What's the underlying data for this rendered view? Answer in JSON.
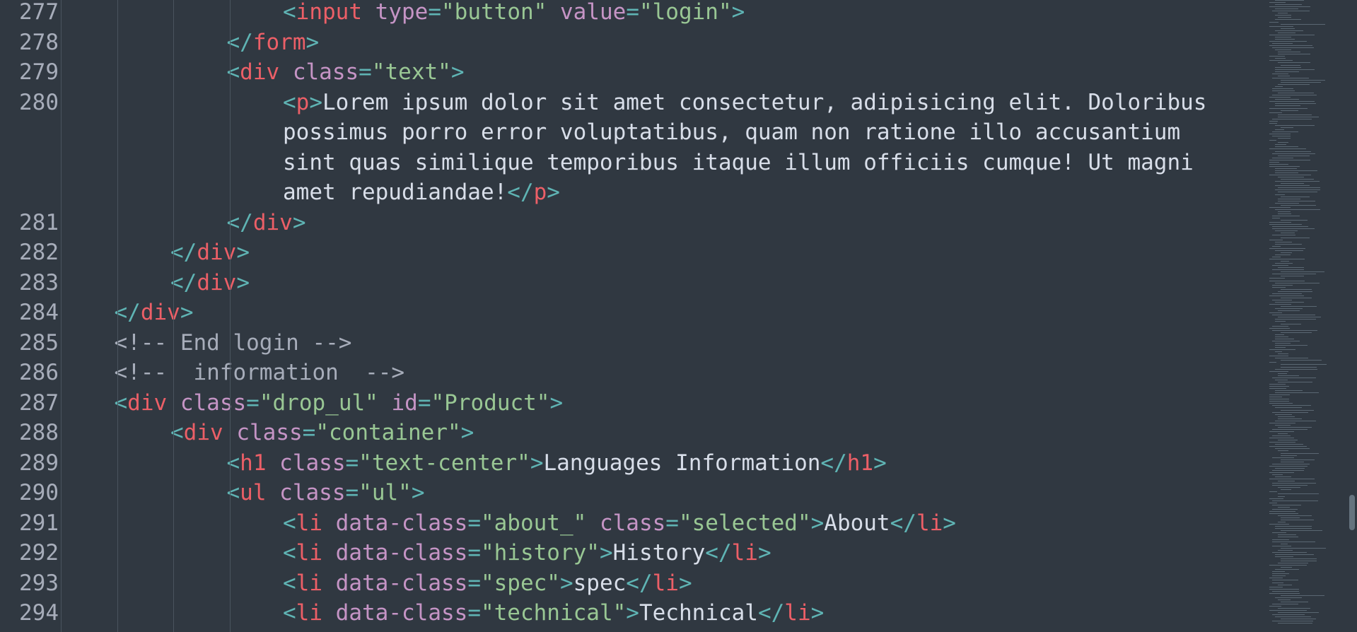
{
  "editor": {
    "lines": [
      {
        "number": "277",
        "indent": 4,
        "tokens": [
          {
            "t": "punct",
            "v": "<"
          },
          {
            "t": "tag",
            "v": "input"
          },
          {
            "t": "txt",
            "v": " "
          },
          {
            "t": "attr",
            "v": "type"
          },
          {
            "t": "punct",
            "v": "="
          },
          {
            "t": "str",
            "v": "\"button\""
          },
          {
            "t": "txt",
            "v": " "
          },
          {
            "t": "attr",
            "v": "value"
          },
          {
            "t": "punct",
            "v": "="
          },
          {
            "t": "str",
            "v": "\"login\""
          },
          {
            "t": "punct",
            "v": ">"
          }
        ]
      },
      {
        "number": "278",
        "indent": 3,
        "tokens": [
          {
            "t": "punct",
            "v": "</"
          },
          {
            "t": "tag",
            "v": "form"
          },
          {
            "t": "punct",
            "v": ">"
          }
        ]
      },
      {
        "number": "279",
        "indent": 3,
        "tokens": [
          {
            "t": "punct",
            "v": "<"
          },
          {
            "t": "tag",
            "v": "div"
          },
          {
            "t": "txt",
            "v": " "
          },
          {
            "t": "attr",
            "v": "class"
          },
          {
            "t": "punct",
            "v": "="
          },
          {
            "t": "str",
            "v": "\"text\""
          },
          {
            "t": "punct",
            "v": ">"
          }
        ]
      },
      {
        "number": "280",
        "indent": 4,
        "wrapped": true,
        "tokens": [
          {
            "t": "punct",
            "v": "<"
          },
          {
            "t": "tag",
            "v": "p"
          },
          {
            "t": "punct",
            "v": ">"
          },
          {
            "t": "txt",
            "v": "Lorem ipsum dolor sit amet consectetur, adipisicing elit. Doloribus possimus porro error voluptatibus, quam non ratione illo accusantium sint quas similique temporibus itaque illum officiis cumque! Ut magni amet repudiandae!"
          },
          {
            "t": "punct",
            "v": "</"
          },
          {
            "t": "tag",
            "v": "p"
          },
          {
            "t": "punct",
            "v": ">"
          }
        ]
      },
      {
        "number": "281",
        "indent": 3,
        "tokens": [
          {
            "t": "punct",
            "v": "</"
          },
          {
            "t": "tag",
            "v": "div"
          },
          {
            "t": "punct",
            "v": ">"
          }
        ]
      },
      {
        "number": "282",
        "indent": 2,
        "tokens": [
          {
            "t": "punct",
            "v": "</"
          },
          {
            "t": "tag",
            "v": "div"
          },
          {
            "t": "punct",
            "v": ">"
          }
        ]
      },
      {
        "number": "283",
        "indent": 2,
        "tokens": [
          {
            "t": "punct",
            "v": "</"
          },
          {
            "t": "tag",
            "v": "div"
          },
          {
            "t": "punct",
            "v": ">"
          }
        ]
      },
      {
        "number": "284",
        "indent": 1,
        "tokens": [
          {
            "t": "punct",
            "v": "</"
          },
          {
            "t": "tag",
            "v": "div"
          },
          {
            "t": "punct",
            "v": ">"
          }
        ]
      },
      {
        "number": "285",
        "indent": 1,
        "tokens": [
          {
            "t": "cmt",
            "v": "<!-- End login -->"
          }
        ]
      },
      {
        "number": "286",
        "indent": 1,
        "tokens": [
          {
            "t": "cmt",
            "v": "<!--  information  -->"
          }
        ]
      },
      {
        "number": "287",
        "indent": 1,
        "tokens": [
          {
            "t": "punct",
            "v": "<"
          },
          {
            "t": "tag",
            "v": "div"
          },
          {
            "t": "txt",
            "v": " "
          },
          {
            "t": "attr",
            "v": "class"
          },
          {
            "t": "punct",
            "v": "="
          },
          {
            "t": "str",
            "v": "\"drop_ul\""
          },
          {
            "t": "txt",
            "v": " "
          },
          {
            "t": "attr",
            "v": "id"
          },
          {
            "t": "punct",
            "v": "="
          },
          {
            "t": "str",
            "v": "\"Product\""
          },
          {
            "t": "punct",
            "v": ">"
          }
        ]
      },
      {
        "number": "288",
        "indent": 2,
        "tokens": [
          {
            "t": "punct",
            "v": "<"
          },
          {
            "t": "tag",
            "v": "div"
          },
          {
            "t": "txt",
            "v": " "
          },
          {
            "t": "attr",
            "v": "class"
          },
          {
            "t": "punct",
            "v": "="
          },
          {
            "t": "str",
            "v": "\"container\""
          },
          {
            "t": "punct",
            "v": ">"
          }
        ]
      },
      {
        "number": "289",
        "indent": 3,
        "tokens": [
          {
            "t": "punct",
            "v": "<"
          },
          {
            "t": "tag",
            "v": "h1"
          },
          {
            "t": "txt",
            "v": " "
          },
          {
            "t": "attr",
            "v": "class"
          },
          {
            "t": "punct",
            "v": "="
          },
          {
            "t": "str",
            "v": "\"text-center\""
          },
          {
            "t": "punct",
            "v": ">"
          },
          {
            "t": "txt",
            "v": "Languages Information"
          },
          {
            "t": "punct",
            "v": "</"
          },
          {
            "t": "tag",
            "v": "h1"
          },
          {
            "t": "punct",
            "v": ">"
          }
        ]
      },
      {
        "number": "290",
        "indent": 3,
        "tokens": [
          {
            "t": "punct",
            "v": "<"
          },
          {
            "t": "tag",
            "v": "ul"
          },
          {
            "t": "txt",
            "v": " "
          },
          {
            "t": "attr",
            "v": "class"
          },
          {
            "t": "punct",
            "v": "="
          },
          {
            "t": "str",
            "v": "\"ul\""
          },
          {
            "t": "punct",
            "v": ">"
          }
        ]
      },
      {
        "number": "291",
        "indent": 4,
        "tokens": [
          {
            "t": "punct",
            "v": "<"
          },
          {
            "t": "tag",
            "v": "li"
          },
          {
            "t": "txt",
            "v": " "
          },
          {
            "t": "attr",
            "v": "data-class"
          },
          {
            "t": "punct",
            "v": "="
          },
          {
            "t": "str",
            "v": "\"about_\""
          },
          {
            "t": "txt",
            "v": " "
          },
          {
            "t": "attr",
            "v": "class"
          },
          {
            "t": "punct",
            "v": "="
          },
          {
            "t": "str",
            "v": "\"selected\""
          },
          {
            "t": "punct",
            "v": ">"
          },
          {
            "t": "txt",
            "v": "About"
          },
          {
            "t": "punct",
            "v": "</"
          },
          {
            "t": "tag",
            "v": "li"
          },
          {
            "t": "punct",
            "v": ">"
          }
        ]
      },
      {
        "number": "292",
        "indent": 4,
        "tokens": [
          {
            "t": "punct",
            "v": "<"
          },
          {
            "t": "tag",
            "v": "li"
          },
          {
            "t": "txt",
            "v": " "
          },
          {
            "t": "attr",
            "v": "data-class"
          },
          {
            "t": "punct",
            "v": "="
          },
          {
            "t": "str",
            "v": "\"history\""
          },
          {
            "t": "punct",
            "v": ">"
          },
          {
            "t": "txt",
            "v": "History"
          },
          {
            "t": "punct",
            "v": "</"
          },
          {
            "t": "tag",
            "v": "li"
          },
          {
            "t": "punct",
            "v": ">"
          }
        ]
      },
      {
        "number": "293",
        "indent": 4,
        "tokens": [
          {
            "t": "punct",
            "v": "<"
          },
          {
            "t": "tag",
            "v": "li"
          },
          {
            "t": "txt",
            "v": " "
          },
          {
            "t": "attr",
            "v": "data-class"
          },
          {
            "t": "punct",
            "v": "="
          },
          {
            "t": "str",
            "v": "\"spec\""
          },
          {
            "t": "punct",
            "v": ">"
          },
          {
            "t": "txt",
            "v": "spec"
          },
          {
            "t": "punct",
            "v": "</"
          },
          {
            "t": "tag",
            "v": "li"
          },
          {
            "t": "punct",
            "v": ">"
          }
        ]
      },
      {
        "number": "294",
        "indent": 4,
        "tokens": [
          {
            "t": "punct",
            "v": "<"
          },
          {
            "t": "tag",
            "v": "li"
          },
          {
            "t": "txt",
            "v": " "
          },
          {
            "t": "attr",
            "v": "data-class"
          },
          {
            "t": "punct",
            "v": "="
          },
          {
            "t": "str",
            "v": "\"technical\""
          },
          {
            "t": "punct",
            "v": ">"
          },
          {
            "t": "txt",
            "v": "Technical"
          },
          {
            "t": "punct",
            "v": "</"
          },
          {
            "t": "tag",
            "v": "li"
          },
          {
            "t": "punct",
            "v": ">"
          }
        ]
      }
    ]
  },
  "theme": {
    "background": "#303841",
    "line_number": "#a7adba",
    "punctuation": "#5fb4b4",
    "tag": "#ec5f67",
    "attribute": "#c594c5",
    "string": "#99c794",
    "text": "#d8dee9",
    "comment": "#a7adba"
  }
}
